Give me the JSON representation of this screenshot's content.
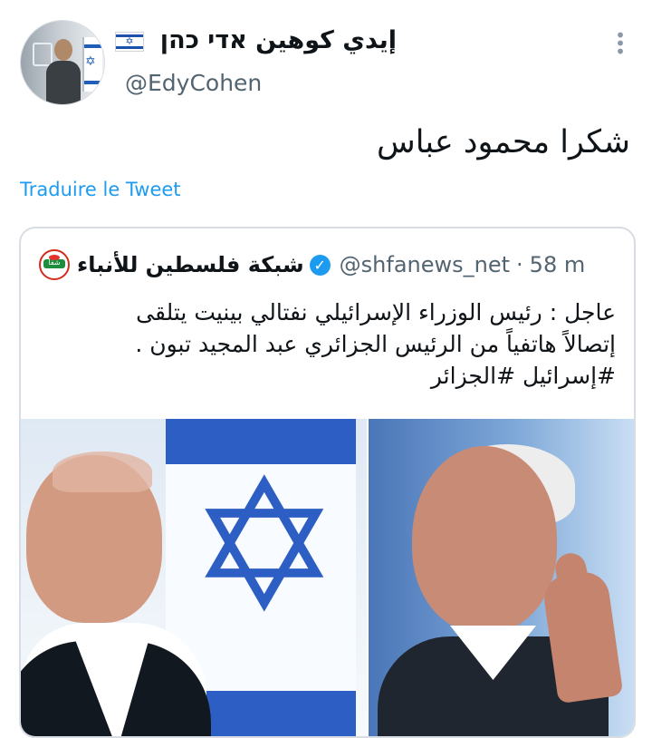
{
  "tweet": {
    "display_name": "إيدي كوهين אדי כהן",
    "handle": "@EdyCohen",
    "text": "شكرا محمود عباس",
    "translate_label": "Traduire le Tweet",
    "flag_icon": "israel-flag-icon",
    "more_icon": "more-vertical-icon"
  },
  "quoted_tweet": {
    "logo_text": "شفا",
    "name": "شبكة فلسطين للأنباء",
    "handle": "@shfanews_net",
    "time": "58 m",
    "lines": [
      "عاجل : رئيس الوزراء الإسرائيلي نفتالي بينيت يتلقى",
      "إتصالاً هاتفياً من الرئيس الجزائري عبد المجيد تبون .",
      "#إسرائيل #الجزائر"
    ]
  },
  "colors": {
    "link": "#1d9bf0",
    "secondary_text": "#536471",
    "verified": "#1d9bf0"
  }
}
